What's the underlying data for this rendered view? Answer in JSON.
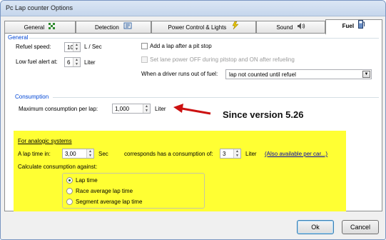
{
  "window": {
    "title": "Pc Lap counter Options"
  },
  "tabs": [
    {
      "label": "General",
      "icon": "green-flag-icon"
    },
    {
      "label": "Detection",
      "icon": "detection-icon"
    },
    {
      "label": "Power Control & Lights",
      "icon": "lightning-icon"
    },
    {
      "label": "Sound",
      "icon": "speaker-icon"
    },
    {
      "label": "Fuel",
      "icon": "fuel-pump-icon",
      "active": true
    }
  ],
  "general": {
    "heading": "General",
    "refuel_speed_label": "Refuel speed:",
    "refuel_speed_value": "10",
    "refuel_speed_unit": "L / Sec",
    "low_fuel_label": "Low fuel alert at:",
    "low_fuel_value": "6",
    "low_fuel_unit": "Liter",
    "add_lap_label": "Add a lap after a pit stop",
    "add_lap_checked": false,
    "lane_power_label": "Set lane power OFF during pitstop and ON after refueling",
    "lane_power_checked": false,
    "runs_out_label": "When a driver runs out of fuel:",
    "runs_out_value": "lap not counted until refuel"
  },
  "consumption": {
    "heading": "Consumption",
    "max_label": "Maximum consumption per lap:",
    "max_value": "1,000",
    "max_unit": "Liter"
  },
  "annotation": {
    "text": "Since version 5.26"
  },
  "analogic": {
    "heading": "For analogic systems",
    "lap_time_label": "A lap time in:",
    "lap_time_value": "3,00",
    "lap_time_unit": "Sec",
    "corresponds_label": "corresponds has a consumption of:",
    "consumption_value": "3",
    "consumption_unit": "Liter",
    "per_car_link": "(Also available per car...)",
    "calculate_label": "Calculate consumption against:",
    "options": [
      {
        "label": "Lap time",
        "selected": true
      },
      {
        "label": "Race average lap time",
        "selected": false
      },
      {
        "label": "Segment average lap time",
        "selected": false
      }
    ]
  },
  "buttons": {
    "ok": "Ok",
    "cancel": "Cancel"
  },
  "colors": {
    "highlight": "#ffff33",
    "arrow": "#cc1111",
    "group_heading": "#0046d5"
  }
}
